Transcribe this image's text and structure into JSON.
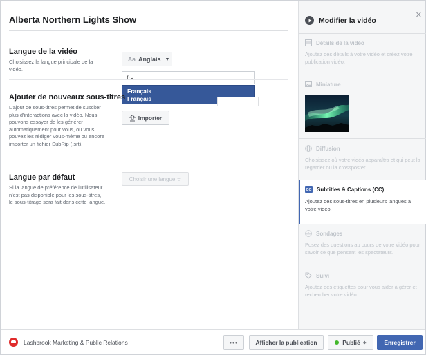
{
  "main": {
    "video_title": "Alberta Northern Lights Show",
    "language_section": {
      "heading": "Langue de la vidéo",
      "description": "Choisissez la langue principale de la vidéo.",
      "selector_prefix": "Aa",
      "selected_language": "Anglais",
      "search_value": "fra",
      "options": [
        "Français",
        "Français"
      ]
    },
    "subtitles_section": {
      "heading": "Ajouter de nouveaux sous-titres",
      "description": "L'ajout de sous-titres permet de susciter plus d'interactions avec la vidéo. Nous pouvons essayer de les générer automatiquement pour vous, ou vous pouvez les rédiger vous-même ou encore importer un fichier SubRip (.srt).",
      "import_label": "Importer"
    },
    "default_language_section": {
      "heading": "Langue par défaut",
      "description": "Si la langue de préférence de l'utilisateur n'est pas disponible pour les sous-titres, le sous-titrage sera fait dans cette langue.",
      "choose_label": "Choisir une langue ≑"
    }
  },
  "sidebar": {
    "title": "Modifier la vidéo",
    "sections": [
      {
        "title": "Détails de la vidéo",
        "description": "Ajoutez des détails à votre vidéo et créez votre publication vidéo.",
        "icon": "details-icon",
        "active": false
      },
      {
        "title": "Miniature",
        "description": "",
        "icon": "image-icon",
        "active": false
      },
      {
        "title": "Diffusion",
        "description": "Choisissez où votre vidéo apparaîtra et qui peut la regarder ou la crossposter.",
        "icon": "globe-icon",
        "active": false
      },
      {
        "title": "Subtitles & Captions (CC)",
        "description": "Ajoutez des sous-titres en plusieurs langues à votre vidéo.",
        "icon": "cc-icon",
        "active": true
      },
      {
        "title": "Sondages",
        "description": "Posez des questions au cours de votre vidéo pour savoir ce que pensent les spectateurs.",
        "icon": "poll-icon",
        "active": false
      },
      {
        "title": "Suivi",
        "description": "Ajoutez des étiquettes pour vous aider à gérer et rechercher votre vidéo.",
        "icon": "tag-icon",
        "active": false
      }
    ]
  },
  "footer": {
    "page_name": "Lashbrook Marketing & Public Relations",
    "more_label": "•••",
    "view_post_label": "Afficher la publication",
    "status_label": "Publié",
    "save_label": "Enregistrer"
  },
  "colors": {
    "accent": "#4267b2",
    "dropdown_highlight": "#365899",
    "status_green": "#42b72a",
    "avatar_red": "#e02b2b"
  }
}
